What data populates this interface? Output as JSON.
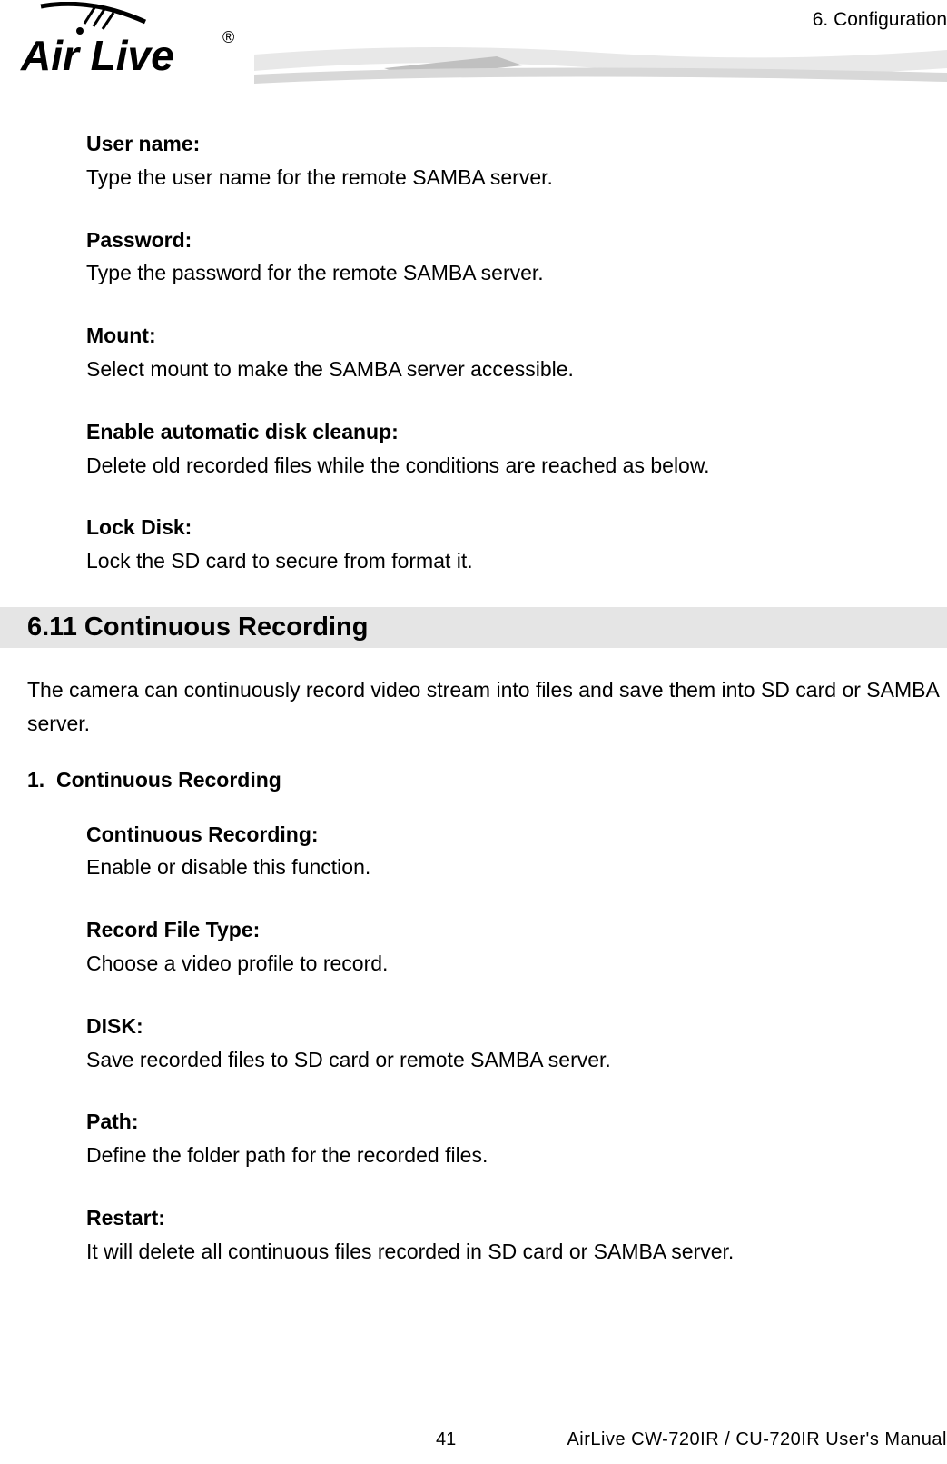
{
  "header": {
    "chapter": "6.  Configuration",
    "logo_text_main": "Air Live",
    "logo_trademark": "®"
  },
  "definitions_top": [
    {
      "term": "User name:",
      "desc": "Type the user name for the remote SAMBA server."
    },
    {
      "term": "Password:",
      "desc": "Type the password for the remote SAMBA server."
    },
    {
      "term": "Mount:",
      "desc": "Select mount to make the SAMBA server accessible."
    },
    {
      "term": "Enable automatic disk cleanup:",
      "desc": "Delete old recorded files while the conditions are reached as below."
    },
    {
      "term": "Lock Disk:",
      "desc": "Lock the SD card to secure from format it."
    }
  ],
  "section": {
    "heading": "6.11 Continuous Recording",
    "intro": "The camera can continuously record video stream into files and save them into SD card or SAMBA server.",
    "sub_number": "1.",
    "sub_title": "Continuous Recording"
  },
  "definitions_bottom": [
    {
      "term": "Continuous Recording:",
      "desc": "Enable or disable this function."
    },
    {
      "term": "Record File Type:",
      "desc": "Choose a video profile to record."
    },
    {
      "term": "DISK:",
      "desc": "Save recorded files to SD card or remote SAMBA server."
    },
    {
      "term": "Path:",
      "desc": "Define the folder path for the recorded files."
    },
    {
      "term": "Restart:",
      "desc": "It will delete all continuous files recorded in SD card or SAMBA server."
    }
  ],
  "footer": {
    "page_number": "41",
    "manual_title": "AirLive  CW-720IR  /  CU-720IR  User's  Manual"
  }
}
